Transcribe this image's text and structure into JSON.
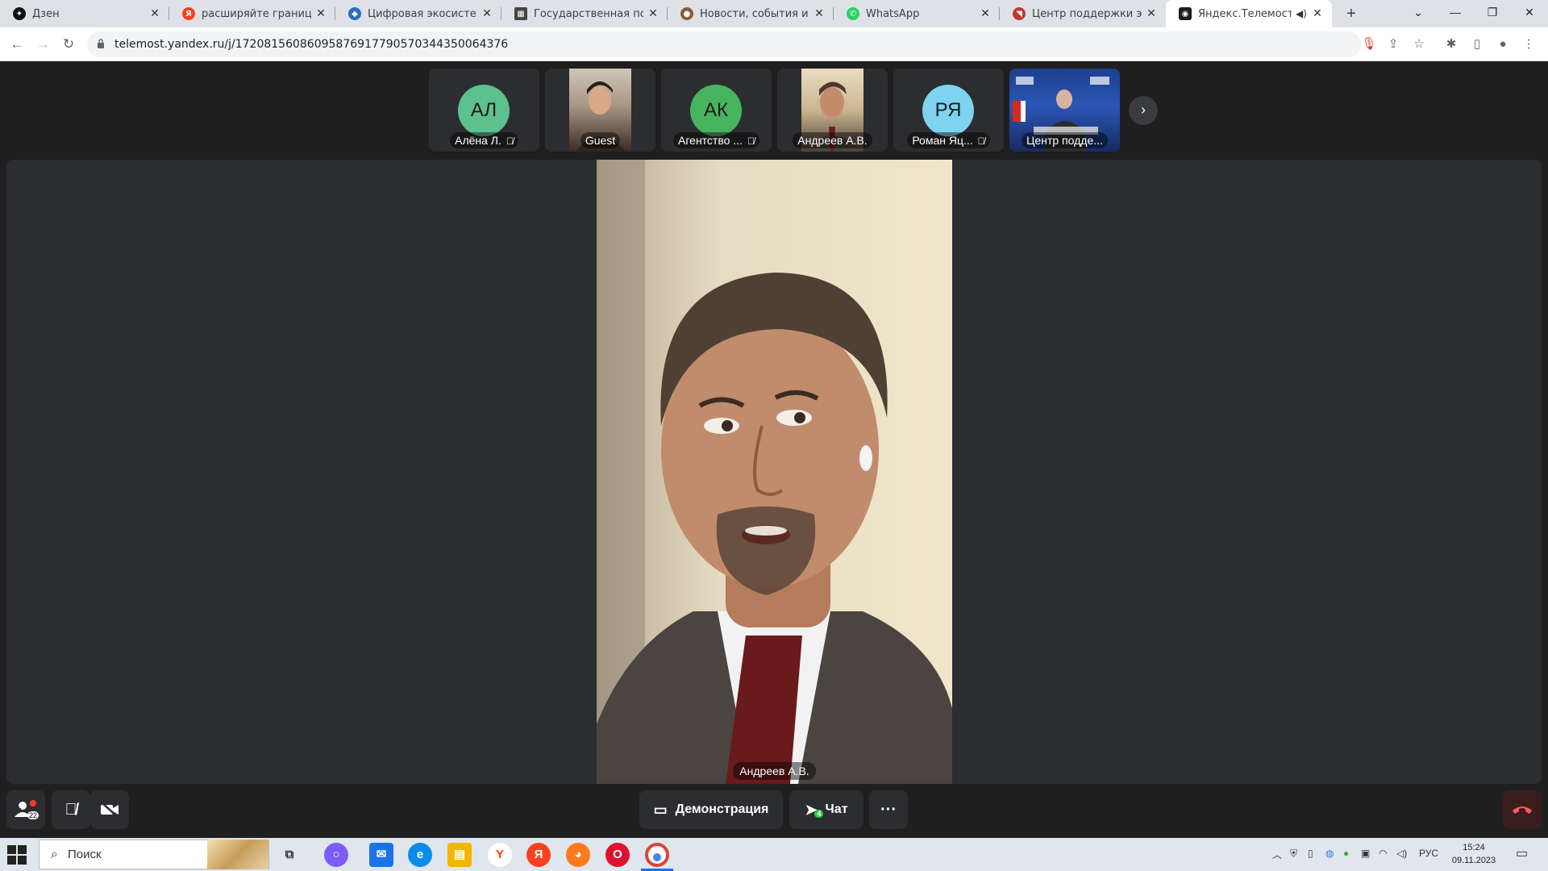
{
  "browser": {
    "tabs": [
      {
        "title": "Дзен",
        "active": false
      },
      {
        "title": "расширяйте границы ме",
        "active": false
      },
      {
        "title": "Цифровая экосистема «",
        "active": false
      },
      {
        "title": "Государственная поддер",
        "active": false
      },
      {
        "title": "Новости, события и т.д.",
        "active": false
      },
      {
        "title": "WhatsApp",
        "active": false
      },
      {
        "title": "Центр поддержки экспор",
        "active": false
      },
      {
        "title": "Яндекс.Телемост",
        "active": true
      }
    ],
    "url": "telemost.yandex.ru/j/17208156086095876917790570344350064376"
  },
  "telemost": {
    "participants": [
      {
        "initials": "АЛ",
        "name": "Алёна Л.",
        "muted": true,
        "color": "#5cc18f",
        "kind": "avatar"
      },
      {
        "initials": "",
        "name": "Guest",
        "muted": false,
        "color": "",
        "kind": "photo"
      },
      {
        "initials": "АК",
        "name": "Агентство ...",
        "muted": true,
        "color": "#48b35e",
        "kind": "avatar"
      },
      {
        "initials": "",
        "name": "Андреев А.В.",
        "muted": false,
        "color": "",
        "kind": "photo"
      },
      {
        "initials": "РЯ",
        "name": "Роман Яц...",
        "muted": true,
        "color": "#7dd3f0",
        "kind": "avatar"
      },
      {
        "initials": "",
        "name": "Центр подде...",
        "muted": false,
        "color": "",
        "kind": "photo"
      }
    ],
    "main_speaker": "Андреев А.В.",
    "controls": {
      "participants_count": "22",
      "screen_share_label": "Демонстрация",
      "chat_label": "Чат",
      "chat_badge": "4"
    }
  },
  "taskbar": {
    "search_placeholder": "Поиск",
    "language": "РУС",
    "time": "15:24",
    "date": "09.11.2023"
  }
}
